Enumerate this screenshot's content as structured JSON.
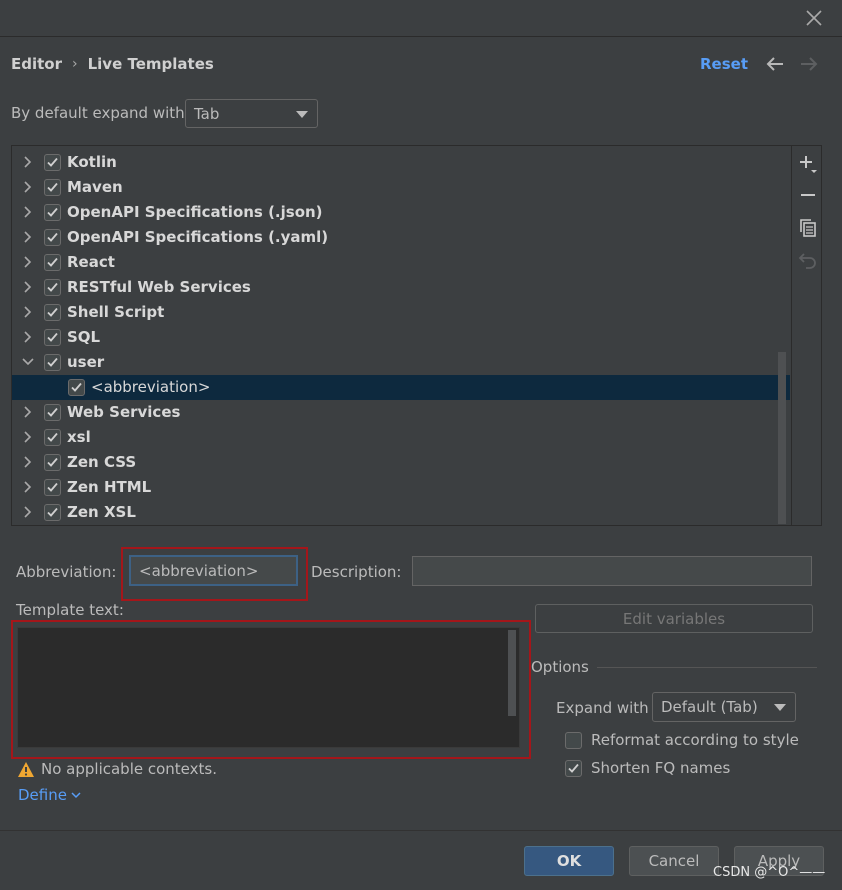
{
  "breadcrumb": {
    "parent": "Editor",
    "separator": "›",
    "current": "Live Templates"
  },
  "header": {
    "reset_label": "Reset"
  },
  "expand_default": {
    "label": "By default expand with",
    "value": "Tab"
  },
  "tree": {
    "items": [
      {
        "label": "Kotlin",
        "checked": true,
        "expanded": false
      },
      {
        "label": "Maven",
        "checked": true,
        "expanded": false
      },
      {
        "label": "OpenAPI Specifications (.json)",
        "checked": true,
        "expanded": false
      },
      {
        "label": "OpenAPI Specifications (.yaml)",
        "checked": true,
        "expanded": false
      },
      {
        "label": "React",
        "checked": true,
        "expanded": false
      },
      {
        "label": "RESTful Web Services",
        "checked": true,
        "expanded": false
      },
      {
        "label": "Shell Script",
        "checked": true,
        "expanded": false
      },
      {
        "label": "SQL",
        "checked": true,
        "expanded": false
      },
      {
        "label": "user",
        "checked": true,
        "expanded": true
      },
      {
        "label": "<abbreviation>",
        "checked": true,
        "child": true,
        "selected": true
      },
      {
        "label": "Web Services",
        "checked": true,
        "expanded": false
      },
      {
        "label": "xsl",
        "checked": true,
        "expanded": false
      },
      {
        "label": "Zen CSS",
        "checked": true,
        "expanded": false
      },
      {
        "label": "Zen HTML",
        "checked": true,
        "expanded": false
      },
      {
        "label": "Zen XSL",
        "checked": true,
        "expanded": false
      }
    ],
    "toolbar_icons": [
      "add-icon",
      "remove-icon",
      "copy-icon",
      "undo-icon"
    ]
  },
  "editor": {
    "abbreviation_label": "Abbreviation:",
    "abbreviation_value": "<abbreviation>",
    "description_label": "Description:",
    "description_value": "",
    "template_text_label": "Template text:",
    "template_text_value": "",
    "edit_variables_label": "Edit variables"
  },
  "options": {
    "title": "Options",
    "expand_with_label": "Expand with",
    "expand_with_value": "Default (Tab)",
    "reformat_label": "Reformat according to style",
    "reformat_checked": false,
    "shorten_label": "Shorten FQ names",
    "shorten_checked": true
  },
  "contexts": {
    "warning_text": "No applicable contexts.",
    "define_label": "Define"
  },
  "footer": {
    "ok_label": "OK",
    "cancel_label": "Cancel",
    "apply_label": "Apply"
  },
  "watermark": "CSDN @^O^——",
  "colors": {
    "background": "#3c3f41",
    "link": "#589df6",
    "selection": "#0d293e",
    "highlight_border": "#a4161a",
    "primary_button": "#365880",
    "warning": "#f0a732"
  }
}
